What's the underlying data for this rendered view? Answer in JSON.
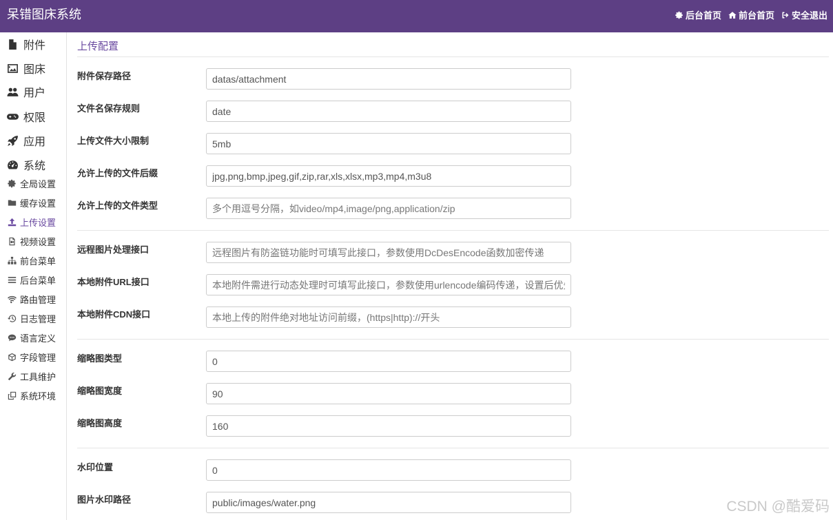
{
  "app": {
    "title": "呆错图床系统"
  },
  "header": {
    "links": [
      {
        "label": "后台首页",
        "icon": "gear-icon"
      },
      {
        "label": "前台首页",
        "icon": "home-icon"
      },
      {
        "label": "安全退出",
        "icon": "sign-out-icon"
      }
    ]
  },
  "sidebar": {
    "items": [
      {
        "label": "附件",
        "icon": "file-icon"
      },
      {
        "label": "图床",
        "icon": "image-icon"
      },
      {
        "label": "用户",
        "icon": "users-icon"
      },
      {
        "label": "权限",
        "icon": "gamepad-icon"
      },
      {
        "label": "应用",
        "icon": "rocket-icon"
      },
      {
        "label": "系统",
        "icon": "dashboard-icon"
      }
    ],
    "subitems": [
      {
        "label": "全局设置",
        "icon": "gear-icon"
      },
      {
        "label": "缓存设置",
        "icon": "folder-icon"
      },
      {
        "label": "上传设置",
        "icon": "upload-icon",
        "active": true
      },
      {
        "label": "视频设置",
        "icon": "video-file-icon"
      },
      {
        "label": "前台菜单",
        "icon": "sitemap-icon"
      },
      {
        "label": "后台菜单",
        "icon": "list-icon"
      },
      {
        "label": "路由管理",
        "icon": "wifi-icon"
      },
      {
        "label": "日志管理",
        "icon": "history-icon"
      },
      {
        "label": "语言定义",
        "icon": "comment-icon"
      },
      {
        "label": "字段管理",
        "icon": "cube-icon"
      },
      {
        "label": "工具维护",
        "icon": "wrench-icon"
      },
      {
        "label": "系统环境",
        "icon": "clone-icon"
      }
    ]
  },
  "main": {
    "section_title": "上传配置",
    "fields": [
      {
        "label": "附件保存路径",
        "value": "datas/attachment",
        "placeholder": ""
      },
      {
        "label": "文件名保存规则",
        "value": "date",
        "placeholder": ""
      },
      {
        "label": "上传文件大小限制",
        "value": "5mb",
        "placeholder": ""
      },
      {
        "label": "允许上传的文件后缀",
        "value": "jpg,png,bmp,jpeg,gif,zip,rar,xls,xlsx,mp3,mp4,m3u8",
        "placeholder": ""
      },
      {
        "label": "允许上传的文件类型",
        "value": "",
        "placeholder": "多个用逗号分隔，如video/mp4,image/png,application/zip"
      },
      {
        "label": "远程图片处理接口",
        "value": "",
        "placeholder": "远程图片有防盗链功能时可填写此接口，参数使用DcDesEncode函数加密传递"
      },
      {
        "label": "本地附件URL接口",
        "value": "",
        "placeholder": "本地附件需进行动态处理时可填写此接口，参数使用urlencode编码传递，设置后优先"
      },
      {
        "label": "本地附件CDN接口",
        "value": "",
        "placeholder": "本地上传的附件绝对地址访问前缀，(https|http)://开头"
      },
      {
        "label": "缩略图类型",
        "value": "0",
        "placeholder": ""
      },
      {
        "label": "缩略图宽度",
        "value": "90",
        "placeholder": ""
      },
      {
        "label": "缩略图高度",
        "value": "160",
        "placeholder": ""
      },
      {
        "label": "水印位置",
        "value": "0",
        "placeholder": ""
      },
      {
        "label": "图片水印路径",
        "value": "public/images/water.png",
        "placeholder": ""
      }
    ]
  },
  "watermark": "CSDN @酷爱码",
  "colors": {
    "header_bg": "#5d3f84",
    "accent": "#6a4aa0"
  }
}
